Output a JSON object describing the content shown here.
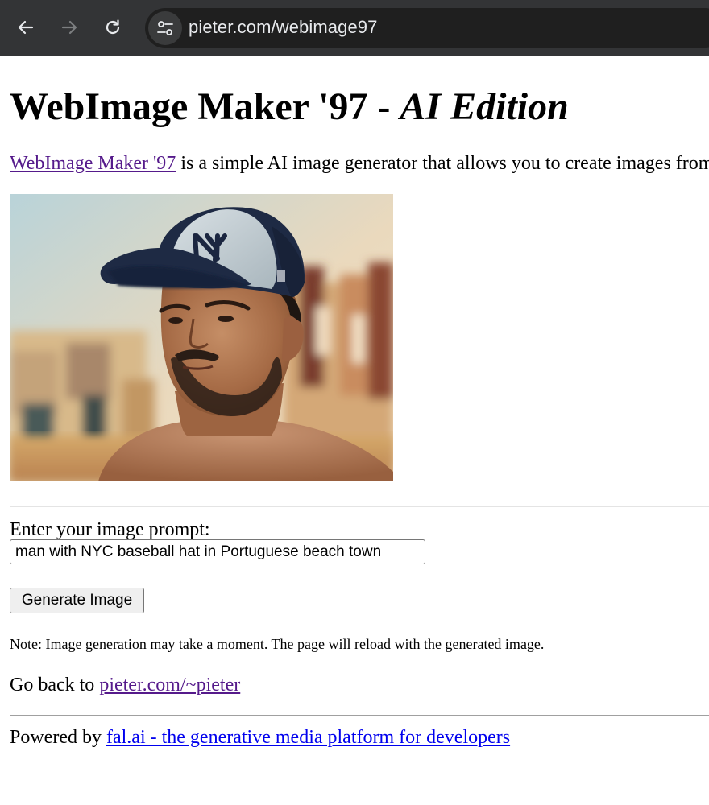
{
  "browser": {
    "url": "pieter.com/webimage97",
    "back_icon": "arrow-left-icon",
    "forward_icon": "arrow-right-icon",
    "reload_icon": "reload-icon",
    "site_info_icon": "tune-icon",
    "colors": {
      "toolbar_bg": "#333436",
      "omnibox_bg": "#1f1f1f",
      "text": "#e8eaed",
      "forward_disabled": "#7c7e80"
    }
  },
  "page": {
    "title_plain": "WebImage Maker '97 - ",
    "title_italic": "AI Edition",
    "intro_link": "WebImage Maker '97",
    "intro_text": " is a simple AI image generator that allows you to create images from",
    "image_alt": "man with NYC baseball hat in Portuguese beach town",
    "prompt_label": "Enter your image prompt:",
    "prompt_value": "man with NYC baseball hat in Portuguese beach town",
    "generate_button": "Generate Image",
    "note": "Note: Image generation may take a moment. The page will reload with the generated image.",
    "goback_text": "Go back to ",
    "goback_link": "pieter.com/~pieter",
    "powered_text": "Powered by ",
    "powered_link": "fal.ai - the generative media platform for developers",
    "colors": {
      "visited_link": "#551a8b",
      "link": "#0000ee"
    }
  }
}
